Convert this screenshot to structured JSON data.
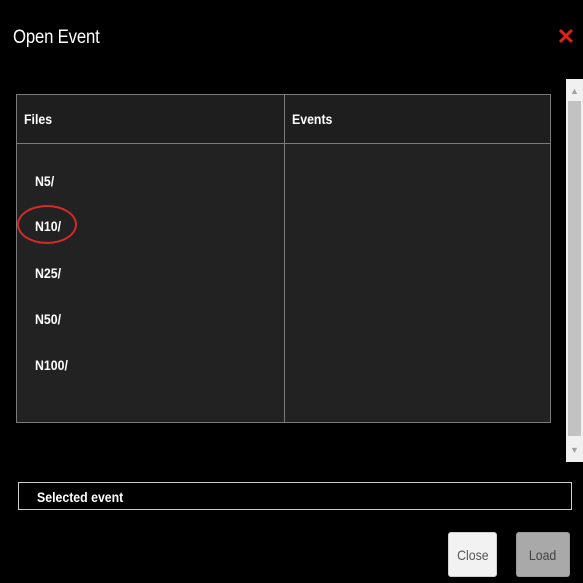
{
  "dialog": {
    "title": "Open Event",
    "close_icon": "close-x-icon",
    "accent_color": "#e0201c"
  },
  "table": {
    "columns": [
      "Files",
      "Events"
    ],
    "files": [
      "N5/",
      "N10/",
      "N25/",
      "N50/",
      "N100/"
    ],
    "highlighted_file": "N10/",
    "events": []
  },
  "selected_event": {
    "label": "Selected event"
  },
  "buttons": {
    "close_label": "Close",
    "load_label": "Load"
  },
  "scrollbar": {
    "up_icon": "▲",
    "down_icon": "▼"
  }
}
